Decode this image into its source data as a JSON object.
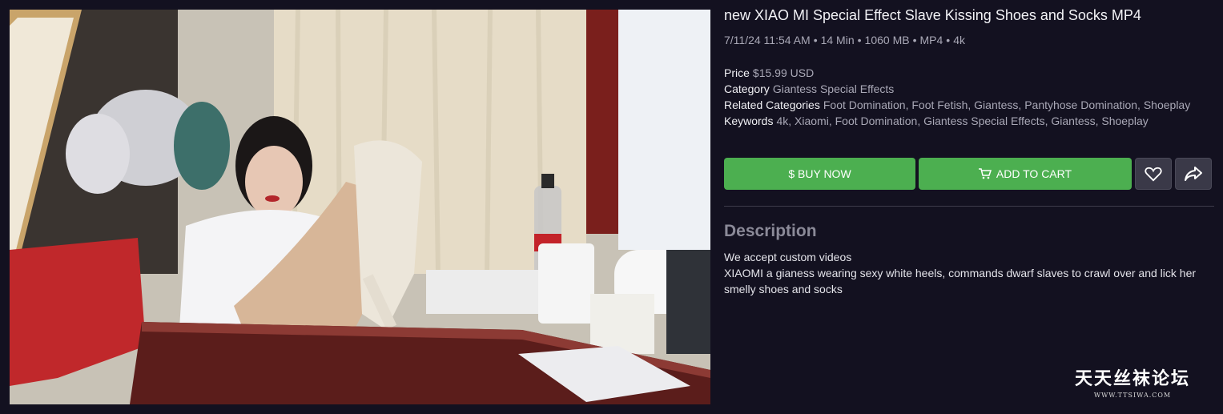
{
  "product": {
    "title": "new XIAO MI Special Effect Slave Kissing Shoes and Socks MP4",
    "meta": {
      "datetime": "7/11/24 11:54 AM",
      "duration": "14 Min",
      "size": "1060 MB",
      "format": "MP4",
      "resolution": "4k",
      "separator": "•"
    },
    "details": {
      "price_label": "Price",
      "price_value": "$15.99 USD",
      "category_label": "Category",
      "category_value": "Giantess Special Effects",
      "related_label": "Related Categories",
      "related_value": "Foot Domination, Foot Fetish, Giantess, Pantyhose Domination, Shoeplay",
      "keywords_label": "Keywords",
      "keywords_value": "4k, Xiaomi, Foot Domination, Giantess Special Effects, Giantess, Shoeplay"
    },
    "actions": {
      "buy_label": "$ BUY NOW",
      "cart_label": "ADD TO CART",
      "favorite_icon": "heart-icon",
      "share_icon": "share-icon",
      "cart_icon": "cart-icon"
    },
    "description": {
      "heading": "Description",
      "line1": "We accept custom videos",
      "line2": "XIAOMI a gianess wearing sexy white heels, commands dwarf slaves to crawl over and lick her smelly shoes and socks"
    }
  },
  "watermark": {
    "main": "天天丝袜论坛",
    "sub": "WWW.TTSIWA.COM"
  },
  "colors": {
    "background": "#131120",
    "accent_green": "#4caf50",
    "muted_text": "#a9a8b6",
    "icon_button": "#3a3948"
  }
}
